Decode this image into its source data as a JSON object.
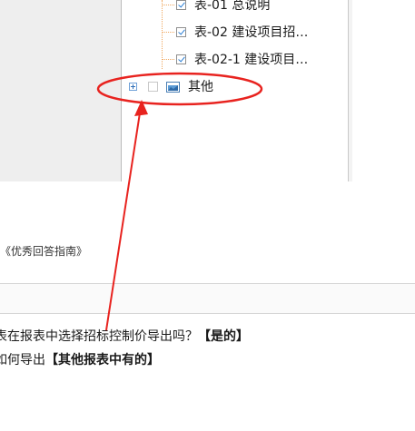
{
  "tree": {
    "items": [
      {
        "label": "表-01 总说明",
        "checked": true
      },
      {
        "label": "表-02 建设项目招…",
        "checked": true
      },
      {
        "label": "表-02-1 建设项目…",
        "checked": true
      }
    ],
    "other_node": {
      "label": "其他",
      "checked": false,
      "icon": "folder-icon",
      "expander": "plus"
    }
  },
  "page": {
    "guide_title": "《优秀回答指南》",
    "answer_line_1": {
      "text": "表在报表中选择招标控制价导出吗？",
      "bold": "【是的】"
    },
    "answer_line_2": {
      "text": "如何导出",
      "bold": "【其他报表中有的】"
    }
  },
  "annotation": {
    "shape": "red ellipse with arrow",
    "color": "#e8231f"
  }
}
